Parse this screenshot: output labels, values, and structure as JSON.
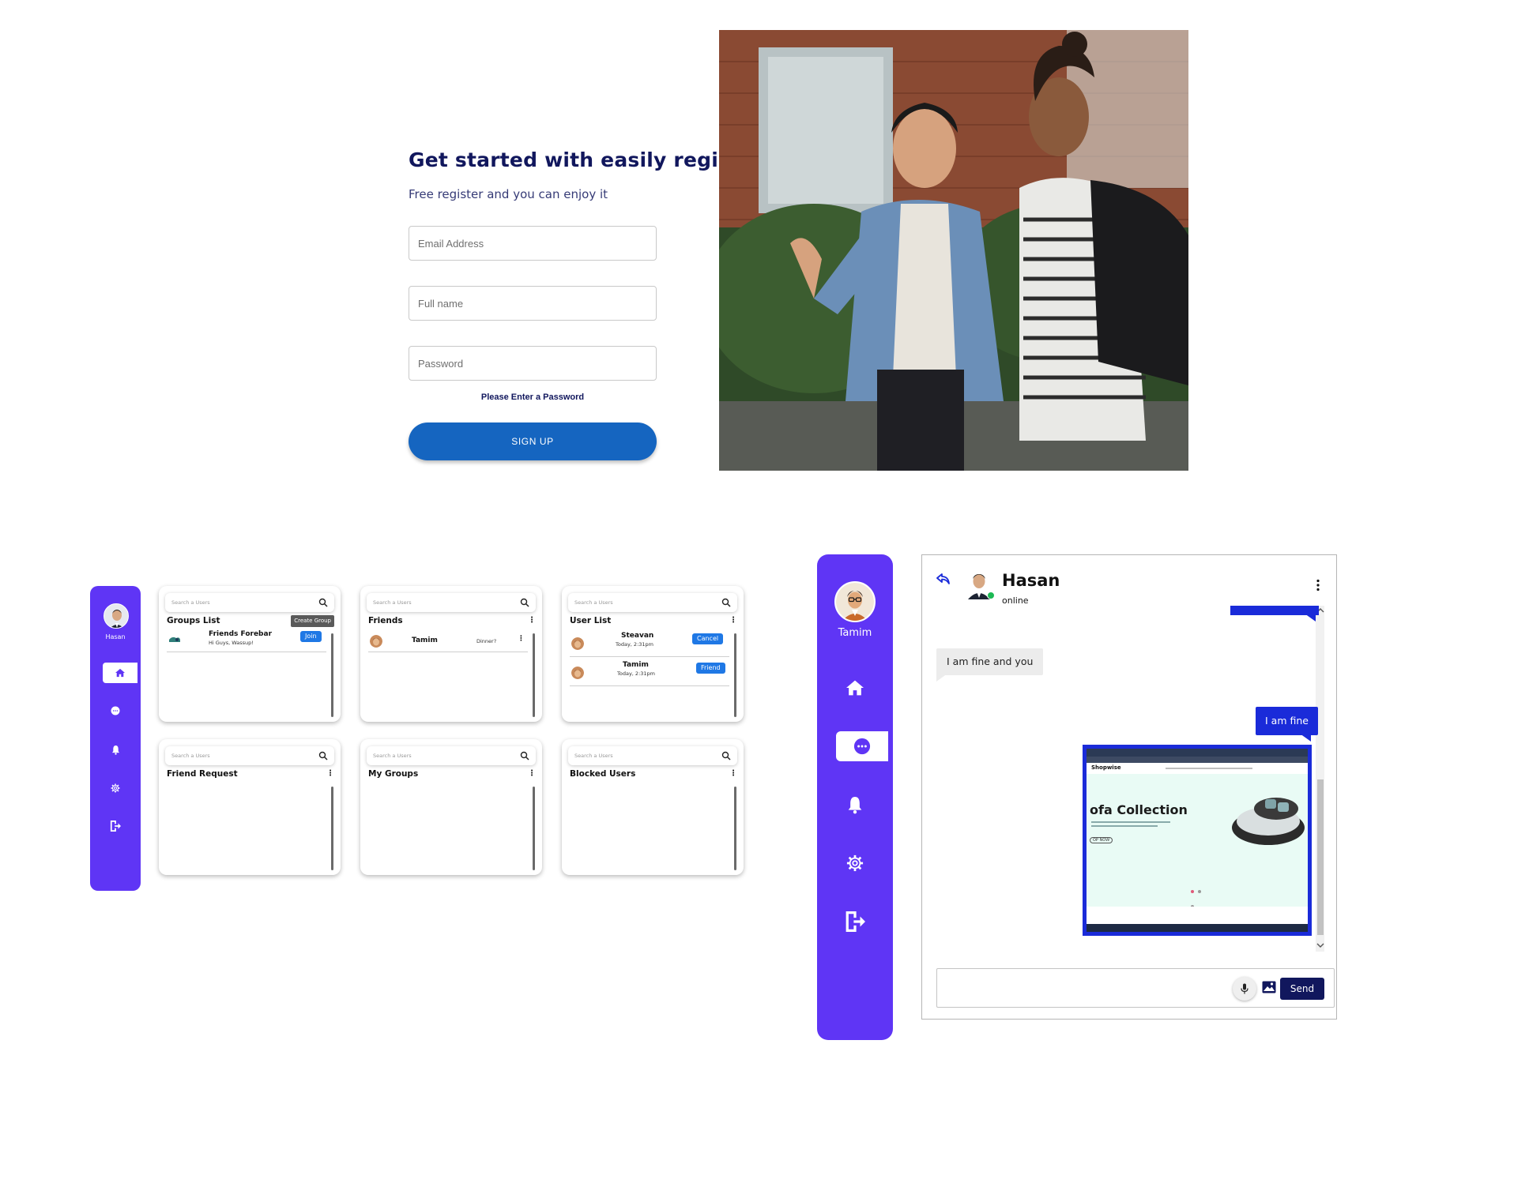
{
  "register": {
    "title": "Get started with easily register",
    "subtitle": "Free register and you can enjoy it",
    "email_placeholder": "Email Address",
    "name_placeholder": "Full name",
    "password_placeholder": "Password",
    "error": "Please Enter a Password",
    "signup_label": "SIGN UP"
  },
  "small_sidebar": {
    "username": "Hasan",
    "items": [
      "home-icon",
      "chat-icon",
      "bell-icon",
      "gear-icon",
      "logout-icon"
    ],
    "active": "home-icon"
  },
  "cards": {
    "search_placeholder": "Search a Users",
    "groups": {
      "title": "Groups List",
      "create_label": "Create Group",
      "items": [
        {
          "name": "Friends Forebar",
          "message": "Hi Guys, Wassup!",
          "action": "Join"
        }
      ]
    },
    "friends": {
      "title": "Friends",
      "items": [
        {
          "name": "Tamim",
          "message": "Dinner?"
        }
      ]
    },
    "user_list": {
      "title": "User List",
      "items": [
        {
          "name": "Steavan",
          "time": "Today, 2:31pm",
          "action": "Cancel"
        },
        {
          "name": "Tamim",
          "time": "Today, 2:31pm",
          "action": "Friend"
        }
      ]
    },
    "friend_request": {
      "title": "Friend Request"
    },
    "my_groups": {
      "title": "My Groups"
    },
    "blocked": {
      "title": "Blocked Users"
    }
  },
  "big_sidebar": {
    "username": "Tamim",
    "items": [
      "home-icon",
      "chat-icon",
      "bell-icon",
      "gear-icon",
      "logout-icon"
    ],
    "active": "chat-icon"
  },
  "chat": {
    "name": "Hasan",
    "status": "online",
    "messages": [
      {
        "side": "in",
        "text": "I am fine and you"
      },
      {
        "side": "out",
        "text": "I am fine"
      },
      {
        "side": "out",
        "type": "image"
      }
    ],
    "shared_image": {
      "brand": "Shopwise",
      "headline": "ofa Collection",
      "cta": "OP NOW"
    },
    "input_placeholder": "",
    "send_label": "Send"
  },
  "colors": {
    "sidebar": "#5f35f5",
    "navy": "#11175d",
    "primary_button": "#1565c0",
    "bubble_out": "#1a2bd9",
    "bubble_in": "#ececec",
    "pill": "#1f78e5",
    "online": "#1db954"
  }
}
